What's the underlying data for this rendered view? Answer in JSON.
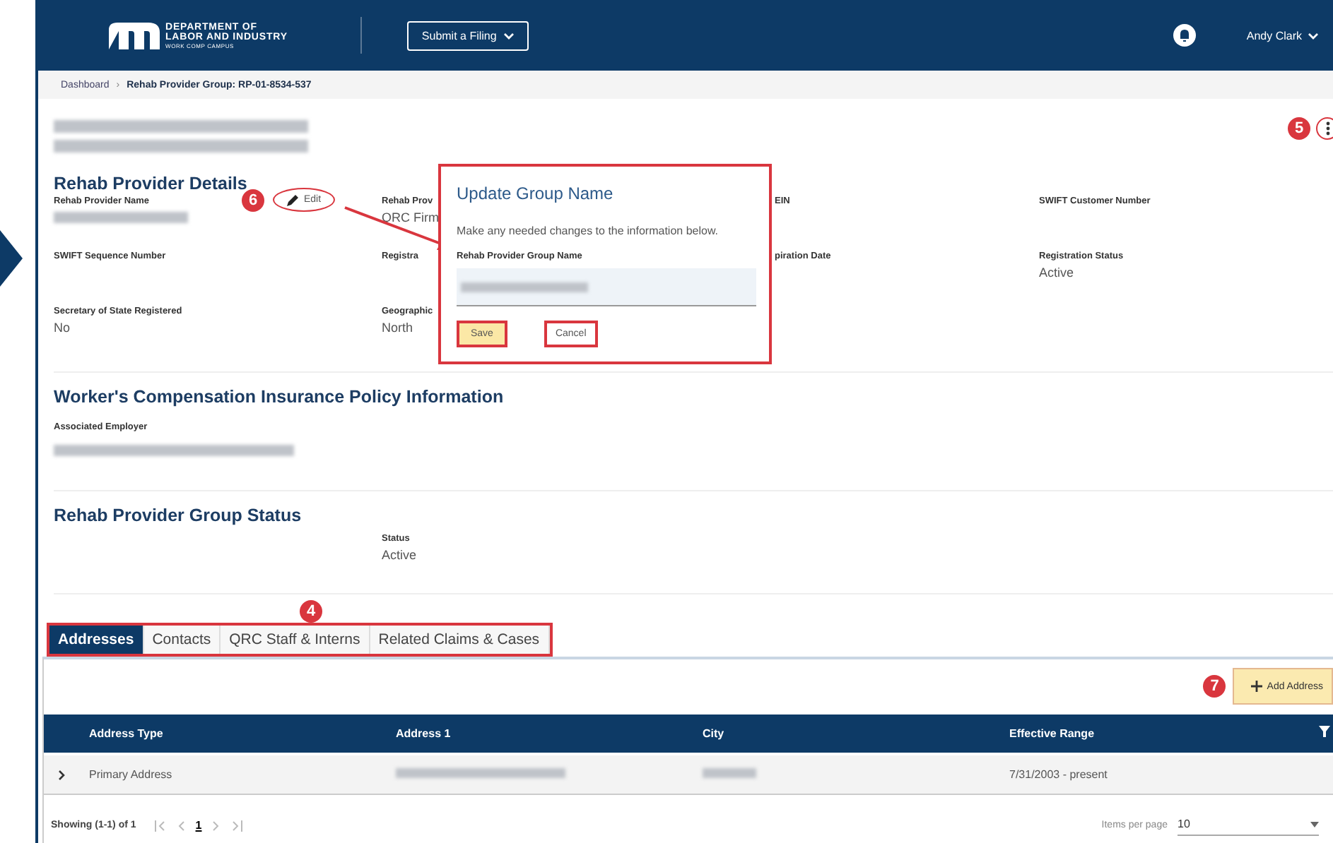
{
  "header": {
    "logo_lines": [
      "DEPARTMENT OF",
      "LABOR AND INDUSTRY",
      "WORK COMP CAMPUS"
    ],
    "menu_button": "Submit a Filing",
    "user": "Andy Clark"
  },
  "breadcrumb_separator": "›",
  "breadcrumb": [
    {
      "label": "Dashboard",
      "current": false
    },
    {
      "label": "Rehab Provider Group: RP-01-8534-537",
      "current": true
    }
  ],
  "menu_callout": "5",
  "details": {
    "heading": "Rehab Provider Details",
    "edit_label": "Edit",
    "callout": "6",
    "fields": [
      {
        "label": "Rehab Provider Name",
        "redacted": true
      },
      {
        "label": "Rehab Prov",
        "value": "QRC Firm"
      },
      {
        "label": "EIN"
      },
      {
        "label": "SWIFT Customer Number"
      },
      {
        "label": "SWIFT Sequence Number"
      },
      {
        "label": "Registra"
      },
      {
        "label": "piration Date"
      },
      {
        "label": "Registration Status",
        "value": "Active"
      },
      {
        "label": "Secretary of State Registered",
        "value": "No"
      },
      {
        "label": "Geographic",
        "value": "North"
      }
    ]
  },
  "modal": {
    "title": "Update Group Name",
    "text": "Make any needed changes to the information below.",
    "field_label": "Rehab Provider Group Name",
    "buttons": [
      {
        "label": "Save",
        "primary": true
      },
      {
        "label": "Cancel",
        "primary": false
      }
    ]
  },
  "insurance": {
    "heading": "Worker's Compensation Insurance Policy Information",
    "label": "Associated Employer"
  },
  "status": {
    "heading": "Rehab Provider Group Status",
    "label": "Status",
    "value": "Active"
  },
  "tabs_callout": "4",
  "tabs": [
    {
      "label": "Addresses",
      "selected": true
    },
    {
      "label": "Contacts",
      "selected": false
    },
    {
      "label": "QRC Staff & Interns",
      "selected": false
    },
    {
      "label": "Related Claims & Cases",
      "selected": false
    }
  ],
  "add_button": {
    "label": "Add Address",
    "callout": "7"
  },
  "table": {
    "columns": [
      "Address Type",
      "Address 1",
      "City",
      "Effective Range"
    ],
    "rows": [
      {
        "address_type": "Primary Address",
        "effective_range": "7/31/2003 - present"
      }
    ]
  },
  "pagination": {
    "summary": "Showing (1-1) of 1",
    "page": "1",
    "items_label": "Items per page",
    "items_value": "10"
  }
}
